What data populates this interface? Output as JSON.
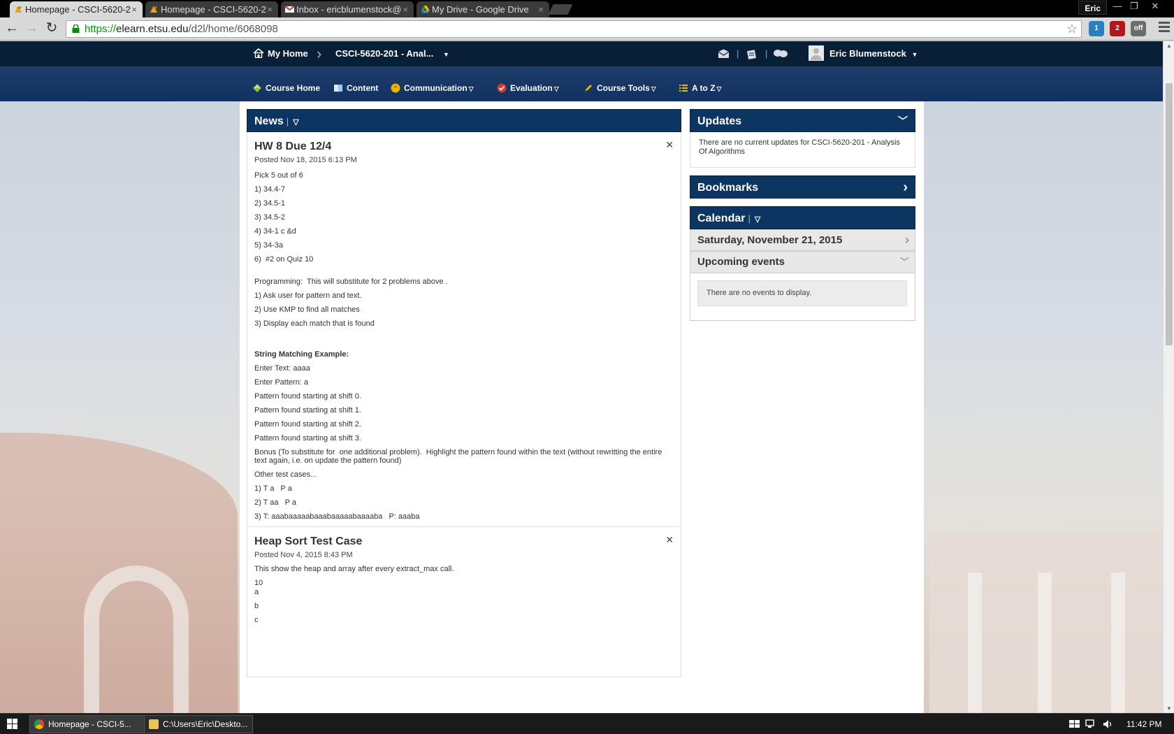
{
  "browser": {
    "tabs": [
      {
        "title": "Homepage - CSCI-5620-2",
        "active": true
      },
      {
        "title": "Homepage - CSCI-5620-2",
        "active": false
      },
      {
        "title": "Inbox - ericblumenstock@",
        "active": false
      },
      {
        "title": "My Drive - Google Drive",
        "active": false
      }
    ],
    "tab_close": "×",
    "profile_name": "Eric",
    "window_controls": {
      "minimize": "—",
      "restore": "❐",
      "close": "✕"
    },
    "url_protocol": "https://",
    "url_host": "elearn.etsu.edu",
    "url_path": "/d2l/home/6068098",
    "nav": {
      "back": "←",
      "forward": "→",
      "reload": "↻",
      "star": "☆"
    },
    "extensions": [
      {
        "name": "ghostery-icon",
        "badge": "1",
        "color": "#2a7fbf"
      },
      {
        "name": "ublock-icon",
        "badge": "2",
        "color": "#b5151b"
      },
      {
        "name": "extension-off-icon",
        "badge": "off",
        "color": "#6c6c6c"
      }
    ]
  },
  "minibar": {
    "home_label": "My Home",
    "breadcrumb_sep": "›",
    "course_label": "CSCI-5620-201 - Anal...",
    "course_caret": "▼",
    "user_name": "Eric Blumenstock",
    "user_caret": "▼",
    "divider": "|"
  },
  "navbar": {
    "items": [
      {
        "label": "Course Home",
        "caret": "",
        "icon_color": "#8bc34a"
      },
      {
        "label": "Content",
        "caret": "",
        "icon_color": "#5aa9e6"
      },
      {
        "label": "Communication",
        "caret": "▽",
        "icon_color": "#f0b400"
      },
      {
        "label": "Evaluation",
        "caret": "▽",
        "icon_color": "#d9362c"
      },
      {
        "label": "Course Tools",
        "caret": "▽",
        "icon_color": "#f0b400"
      },
      {
        "label": "A to Z",
        "caret": "▽",
        "icon_color": "#f0c000"
      }
    ]
  },
  "news": {
    "title": "News",
    "sep": "|",
    "menu_caret": "▽",
    "close_glyph": "✕",
    "items": [
      {
        "title": "HW 8 Due 12/4",
        "posted": "Posted Nov 18, 2015 6:13 PM",
        "lines": [
          {
            "text": "Pick 5 out of 6",
            "style": ""
          },
          {
            "text": "1) 34.4-7",
            "style": ""
          },
          {
            "text": "2) 34.5-1",
            "style": ""
          },
          {
            "text": "3) 34.5-2",
            "style": ""
          },
          {
            "text": "4) 34-1 c &d",
            "style": ""
          },
          {
            "text": "5) 34-3a",
            "style": ""
          },
          {
            "text": "6)  #2 on Quiz 10",
            "style": ""
          },
          {
            "text": "Programming:  This will substitute for 2 problems above .",
            "style": "gap"
          },
          {
            "text": "1) Ask user for pattern and text.",
            "style": ""
          },
          {
            "text": "2) Use KMP to find all matches",
            "style": ""
          },
          {
            "text": "3) Display each match that is found",
            "style": ""
          },
          {
            "text": "String Matching Example:",
            "style": "bold gap"
          },
          {
            "text": "Enter Text: aaaa",
            "style": ""
          },
          {
            "text": "Enter Pattern: a",
            "style": ""
          },
          {
            "text": "Pattern found starting at shift 0.",
            "style": ""
          },
          {
            "text": "Pattern found starting at shift 1.",
            "style": ""
          },
          {
            "text": "Pattern found starting at shift 2.",
            "style": ""
          },
          {
            "text": "Pattern found starting at shift 3.",
            "style": ""
          },
          {
            "text": "Bonus (To substitute for  one additional problem).  Highlight the pattern found within the text (without rewritting the entire text again, i.e. on update the pattern found)",
            "style": ""
          },
          {
            "text": "Other test cases...",
            "style": ""
          },
          {
            "text": "1) T a   P a",
            "style": ""
          },
          {
            "text": "2) T aa   P a",
            "style": ""
          },
          {
            "text": "3) T: aaabaaaaabaaabaaaaabaaaaba   P: aaaba",
            "style": ""
          }
        ]
      },
      {
        "title": "Heap Sort Test Case",
        "posted": "Posted Nov 4, 2015 8:43 PM",
        "lines": [
          {
            "text": "This show the heap and array after every extract_max call.",
            "style": ""
          },
          {
            "text": "10",
            "style": ""
          },
          {
            "text": "a",
            "style": "tight"
          },
          {
            "text": "b",
            "style": ""
          },
          {
            "text": "c",
            "style": ""
          }
        ]
      }
    ]
  },
  "updates": {
    "title": "Updates",
    "toggle": "﹀",
    "message": "There are no current updates for CSCI-5620-201 - Analysis Of Algorithms"
  },
  "bookmarks": {
    "title": "Bookmarks",
    "arrow": "›"
  },
  "calendar": {
    "title": "Calendar",
    "sep": "|",
    "menu_caret": "▽",
    "date": "Saturday, November 21, 2015",
    "date_arrow": "›",
    "upcoming_label": "Upcoming events",
    "upcoming_toggle": "﹀",
    "empty_message": "There are no events to display."
  },
  "taskbar": {
    "items": [
      {
        "label": "Homepage - CSCI-5...",
        "icon_color": "#e8a317"
      },
      {
        "label": "C:\\Users\\Eric\\Deskto...",
        "icon_color": "#e8c45a"
      }
    ],
    "clock": "11:42 PM",
    "tray_icons": [
      "flag-icon",
      "network-icon",
      "volume-icon"
    ]
  }
}
